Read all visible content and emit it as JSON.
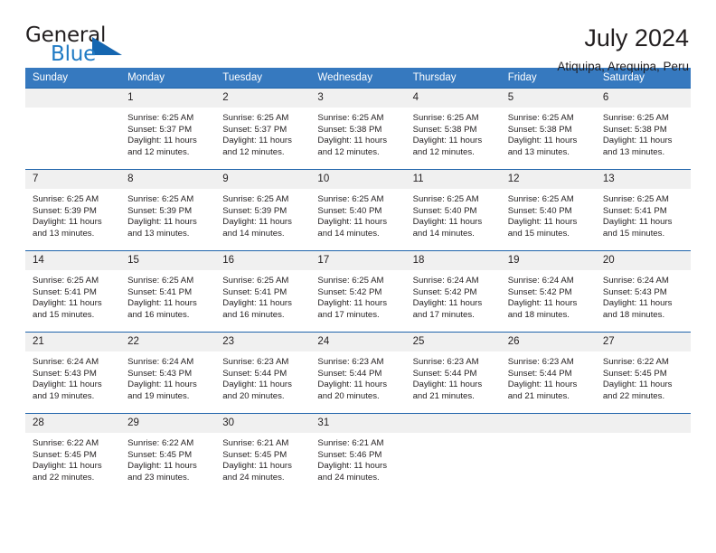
{
  "brand": {
    "name_primary": "General",
    "name_secondary": "Blue",
    "triangle_color": "#1566b0",
    "blue_color": "#1f7ac4"
  },
  "header": {
    "title": "July 2024",
    "subtitle": "Atiquipa, Arequipa, Peru"
  },
  "theme": {
    "header_bg": "#3679bf",
    "row_divider": "#1f64ab",
    "daynum_bg": "#f0f0f0",
    "text": "#231f20"
  },
  "weekdays": [
    "Sunday",
    "Monday",
    "Tuesday",
    "Wednesday",
    "Thursday",
    "Friday",
    "Saturday"
  ],
  "labels": {
    "sunrise_prefix": "Sunrise: ",
    "sunset_prefix": "Sunset: ",
    "daylight_prefix": "Daylight: "
  },
  "weeks": [
    [
      {
        "day": "",
        "empty": true
      },
      {
        "day": "1",
        "sunrise": "Sunrise: 6:25 AM",
        "sunset": "Sunset: 5:37 PM",
        "daylight1": "Daylight: 11 hours",
        "daylight2": "and 12 minutes."
      },
      {
        "day": "2",
        "sunrise": "Sunrise: 6:25 AM",
        "sunset": "Sunset: 5:37 PM",
        "daylight1": "Daylight: 11 hours",
        "daylight2": "and 12 minutes."
      },
      {
        "day": "3",
        "sunrise": "Sunrise: 6:25 AM",
        "sunset": "Sunset: 5:38 PM",
        "daylight1": "Daylight: 11 hours",
        "daylight2": "and 12 minutes."
      },
      {
        "day": "4",
        "sunrise": "Sunrise: 6:25 AM",
        "sunset": "Sunset: 5:38 PM",
        "daylight1": "Daylight: 11 hours",
        "daylight2": "and 12 minutes."
      },
      {
        "day": "5",
        "sunrise": "Sunrise: 6:25 AM",
        "sunset": "Sunset: 5:38 PM",
        "daylight1": "Daylight: 11 hours",
        "daylight2": "and 13 minutes."
      },
      {
        "day": "6",
        "sunrise": "Sunrise: 6:25 AM",
        "sunset": "Sunset: 5:38 PM",
        "daylight1": "Daylight: 11 hours",
        "daylight2": "and 13 minutes."
      }
    ],
    [
      {
        "day": "7",
        "sunrise": "Sunrise: 6:25 AM",
        "sunset": "Sunset: 5:39 PM",
        "daylight1": "Daylight: 11 hours",
        "daylight2": "and 13 minutes."
      },
      {
        "day": "8",
        "sunrise": "Sunrise: 6:25 AM",
        "sunset": "Sunset: 5:39 PM",
        "daylight1": "Daylight: 11 hours",
        "daylight2": "and 13 minutes."
      },
      {
        "day": "9",
        "sunrise": "Sunrise: 6:25 AM",
        "sunset": "Sunset: 5:39 PM",
        "daylight1": "Daylight: 11 hours",
        "daylight2": "and 14 minutes."
      },
      {
        "day": "10",
        "sunrise": "Sunrise: 6:25 AM",
        "sunset": "Sunset: 5:40 PM",
        "daylight1": "Daylight: 11 hours",
        "daylight2": "and 14 minutes."
      },
      {
        "day": "11",
        "sunrise": "Sunrise: 6:25 AM",
        "sunset": "Sunset: 5:40 PM",
        "daylight1": "Daylight: 11 hours",
        "daylight2": "and 14 minutes."
      },
      {
        "day": "12",
        "sunrise": "Sunrise: 6:25 AM",
        "sunset": "Sunset: 5:40 PM",
        "daylight1": "Daylight: 11 hours",
        "daylight2": "and 15 minutes."
      },
      {
        "day": "13",
        "sunrise": "Sunrise: 6:25 AM",
        "sunset": "Sunset: 5:41 PM",
        "daylight1": "Daylight: 11 hours",
        "daylight2": "and 15 minutes."
      }
    ],
    [
      {
        "day": "14",
        "sunrise": "Sunrise: 6:25 AM",
        "sunset": "Sunset: 5:41 PM",
        "daylight1": "Daylight: 11 hours",
        "daylight2": "and 15 minutes."
      },
      {
        "day": "15",
        "sunrise": "Sunrise: 6:25 AM",
        "sunset": "Sunset: 5:41 PM",
        "daylight1": "Daylight: 11 hours",
        "daylight2": "and 16 minutes."
      },
      {
        "day": "16",
        "sunrise": "Sunrise: 6:25 AM",
        "sunset": "Sunset: 5:41 PM",
        "daylight1": "Daylight: 11 hours",
        "daylight2": "and 16 minutes."
      },
      {
        "day": "17",
        "sunrise": "Sunrise: 6:25 AM",
        "sunset": "Sunset: 5:42 PM",
        "daylight1": "Daylight: 11 hours",
        "daylight2": "and 17 minutes."
      },
      {
        "day": "18",
        "sunrise": "Sunrise: 6:24 AM",
        "sunset": "Sunset: 5:42 PM",
        "daylight1": "Daylight: 11 hours",
        "daylight2": "and 17 minutes."
      },
      {
        "day": "19",
        "sunrise": "Sunrise: 6:24 AM",
        "sunset": "Sunset: 5:42 PM",
        "daylight1": "Daylight: 11 hours",
        "daylight2": "and 18 minutes."
      },
      {
        "day": "20",
        "sunrise": "Sunrise: 6:24 AM",
        "sunset": "Sunset: 5:43 PM",
        "daylight1": "Daylight: 11 hours",
        "daylight2": "and 18 minutes."
      }
    ],
    [
      {
        "day": "21",
        "sunrise": "Sunrise: 6:24 AM",
        "sunset": "Sunset: 5:43 PM",
        "daylight1": "Daylight: 11 hours",
        "daylight2": "and 19 minutes."
      },
      {
        "day": "22",
        "sunrise": "Sunrise: 6:24 AM",
        "sunset": "Sunset: 5:43 PM",
        "daylight1": "Daylight: 11 hours",
        "daylight2": "and 19 minutes."
      },
      {
        "day": "23",
        "sunrise": "Sunrise: 6:23 AM",
        "sunset": "Sunset: 5:44 PM",
        "daylight1": "Daylight: 11 hours",
        "daylight2": "and 20 minutes."
      },
      {
        "day": "24",
        "sunrise": "Sunrise: 6:23 AM",
        "sunset": "Sunset: 5:44 PM",
        "daylight1": "Daylight: 11 hours",
        "daylight2": "and 20 minutes."
      },
      {
        "day": "25",
        "sunrise": "Sunrise: 6:23 AM",
        "sunset": "Sunset: 5:44 PM",
        "daylight1": "Daylight: 11 hours",
        "daylight2": "and 21 minutes."
      },
      {
        "day": "26",
        "sunrise": "Sunrise: 6:23 AM",
        "sunset": "Sunset: 5:44 PM",
        "daylight1": "Daylight: 11 hours",
        "daylight2": "and 21 minutes."
      },
      {
        "day": "27",
        "sunrise": "Sunrise: 6:22 AM",
        "sunset": "Sunset: 5:45 PM",
        "daylight1": "Daylight: 11 hours",
        "daylight2": "and 22 minutes."
      }
    ],
    [
      {
        "day": "28",
        "sunrise": "Sunrise: 6:22 AM",
        "sunset": "Sunset: 5:45 PM",
        "daylight1": "Daylight: 11 hours",
        "daylight2": "and 22 minutes."
      },
      {
        "day": "29",
        "sunrise": "Sunrise: 6:22 AM",
        "sunset": "Sunset: 5:45 PM",
        "daylight1": "Daylight: 11 hours",
        "daylight2": "and 23 minutes."
      },
      {
        "day": "30",
        "sunrise": "Sunrise: 6:21 AM",
        "sunset": "Sunset: 5:45 PM",
        "daylight1": "Daylight: 11 hours",
        "daylight2": "and 24 minutes."
      },
      {
        "day": "31",
        "sunrise": "Sunrise: 6:21 AM",
        "sunset": "Sunset: 5:46 PM",
        "daylight1": "Daylight: 11 hours",
        "daylight2": "and 24 minutes."
      },
      {
        "day": "",
        "empty": true
      },
      {
        "day": "",
        "empty": true
      },
      {
        "day": "",
        "empty": true
      }
    ]
  ]
}
